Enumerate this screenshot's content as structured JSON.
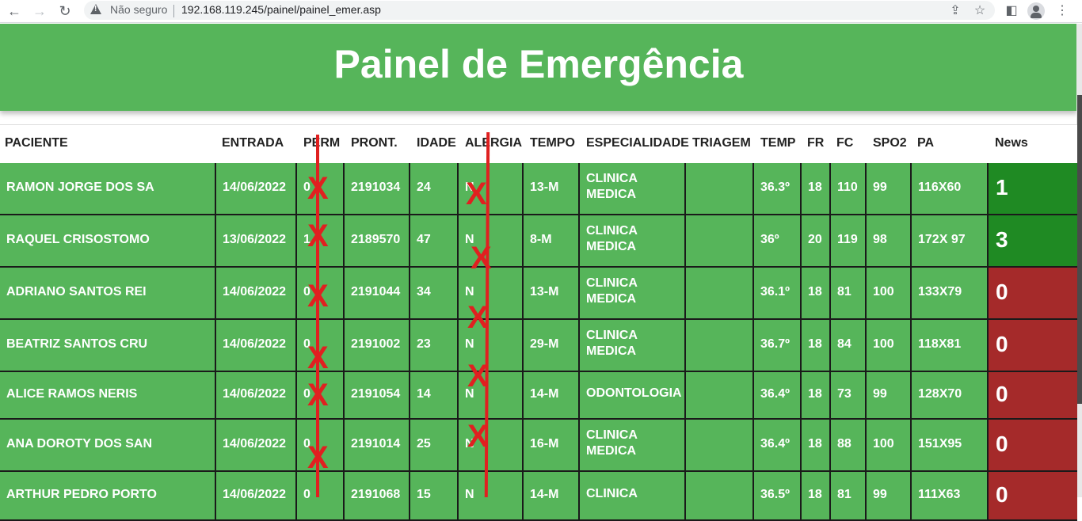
{
  "browser": {
    "security_label": "Não seguro",
    "url": "192.168.119.245/painel/painel_emer.asp"
  },
  "page": {
    "title": "Painel de Emergência"
  },
  "columns": [
    "PACIENTE",
    "ENTRADA",
    "PERM",
    "PRONT.",
    "IDADE",
    "ALERGIA",
    "TEMPO",
    "ESPECIALIDADE",
    "TRIAGEM",
    "TEMP",
    "FR",
    "FC",
    "SPO2",
    "PA",
    "News"
  ],
  "rows": [
    {
      "paciente": "RAMON JORGE DOS SA",
      "entrada": "14/06/2022",
      "perm": "0",
      "pront": "2191034",
      "idade": "24",
      "alergia": "N",
      "tempo": "13-M",
      "esp1": "CLINICA",
      "esp2": "MEDICA",
      "triagem": "",
      "temp": "36.3º",
      "fr": "18",
      "fc": "110",
      "spo2": "99",
      "pa": "116X60",
      "news": "1",
      "news_color": "#1f8a23"
    },
    {
      "paciente": "RAQUEL CRISOSTOMO",
      "entrada": "13/06/2022",
      "perm": "1",
      "pront": "2189570",
      "idade": "47",
      "alergia": "N",
      "tempo": "8-M",
      "esp1": "CLINICA",
      "esp2": "MEDICA",
      "triagem": "",
      "temp": "36º",
      "fr": "20",
      "fc": "119",
      "spo2": "98",
      "pa": "172X 97",
      "news": "3",
      "news_color": "#1f8a23"
    },
    {
      "paciente": "ADRIANO SANTOS REI",
      "entrada": "14/06/2022",
      "perm": "0",
      "pront": "2191044",
      "idade": "34",
      "alergia": "N",
      "tempo": "13-M",
      "esp1": "CLINICA",
      "esp2": "MEDICA",
      "triagem": "",
      "temp": "36.1º",
      "fr": "18",
      "fc": "81",
      "spo2": "100",
      "pa": "133X79",
      "news": "0",
      "news_color": "#a52a2a"
    },
    {
      "paciente": "BEATRIZ SANTOS CRU",
      "entrada": "14/06/2022",
      "perm": "0",
      "pront": "2191002",
      "idade": "23",
      "alergia": "N",
      "tempo": "29-M",
      "esp1": "CLINICA",
      "esp2": "MEDICA",
      "triagem": "",
      "temp": "36.7º",
      "fr": "18",
      "fc": "84",
      "spo2": "100",
      "pa": "118X81",
      "news": "0",
      "news_color": "#a52a2a"
    },
    {
      "paciente": "ALICE RAMOS NERIS",
      "entrada": "14/06/2022",
      "perm": "0",
      "pront": "2191054",
      "idade": "14",
      "alergia": "N",
      "tempo": "14-M",
      "esp1": "ODONTOLOGIA",
      "esp2": "",
      "triagem": "",
      "temp": "36.4º",
      "fr": "18",
      "fc": "73",
      "spo2": "99",
      "pa": "128X70",
      "news": "0",
      "news_color": "#a52a2a"
    },
    {
      "paciente": "ANA DOROTY DOS SAN",
      "entrada": "14/06/2022",
      "perm": "0",
      "pront": "2191014",
      "idade": "25",
      "alergia": "N",
      "tempo": "16-M",
      "esp1": "CLINICA",
      "esp2": "MEDICA",
      "triagem": "",
      "temp": "36.4º",
      "fr": "18",
      "fc": "88",
      "spo2": "100",
      "pa": "151X95",
      "news": "0",
      "news_color": "#a52a2a"
    },
    {
      "paciente": "ARTHUR PEDRO PORTO",
      "entrada": "14/06/2022",
      "perm": "0",
      "pront": "2191068",
      "idade": "15",
      "alergia": "N",
      "tempo": "14-M",
      "esp1": "CLINICA",
      "esp2": "",
      "triagem": "",
      "temp": "36.5º",
      "fr": "18",
      "fc": "81",
      "spo2": "99",
      "pa": "111X63",
      "news": "0",
      "news_color": "#a52a2a"
    }
  ],
  "annotations": {
    "strike_mark": "X"
  }
}
